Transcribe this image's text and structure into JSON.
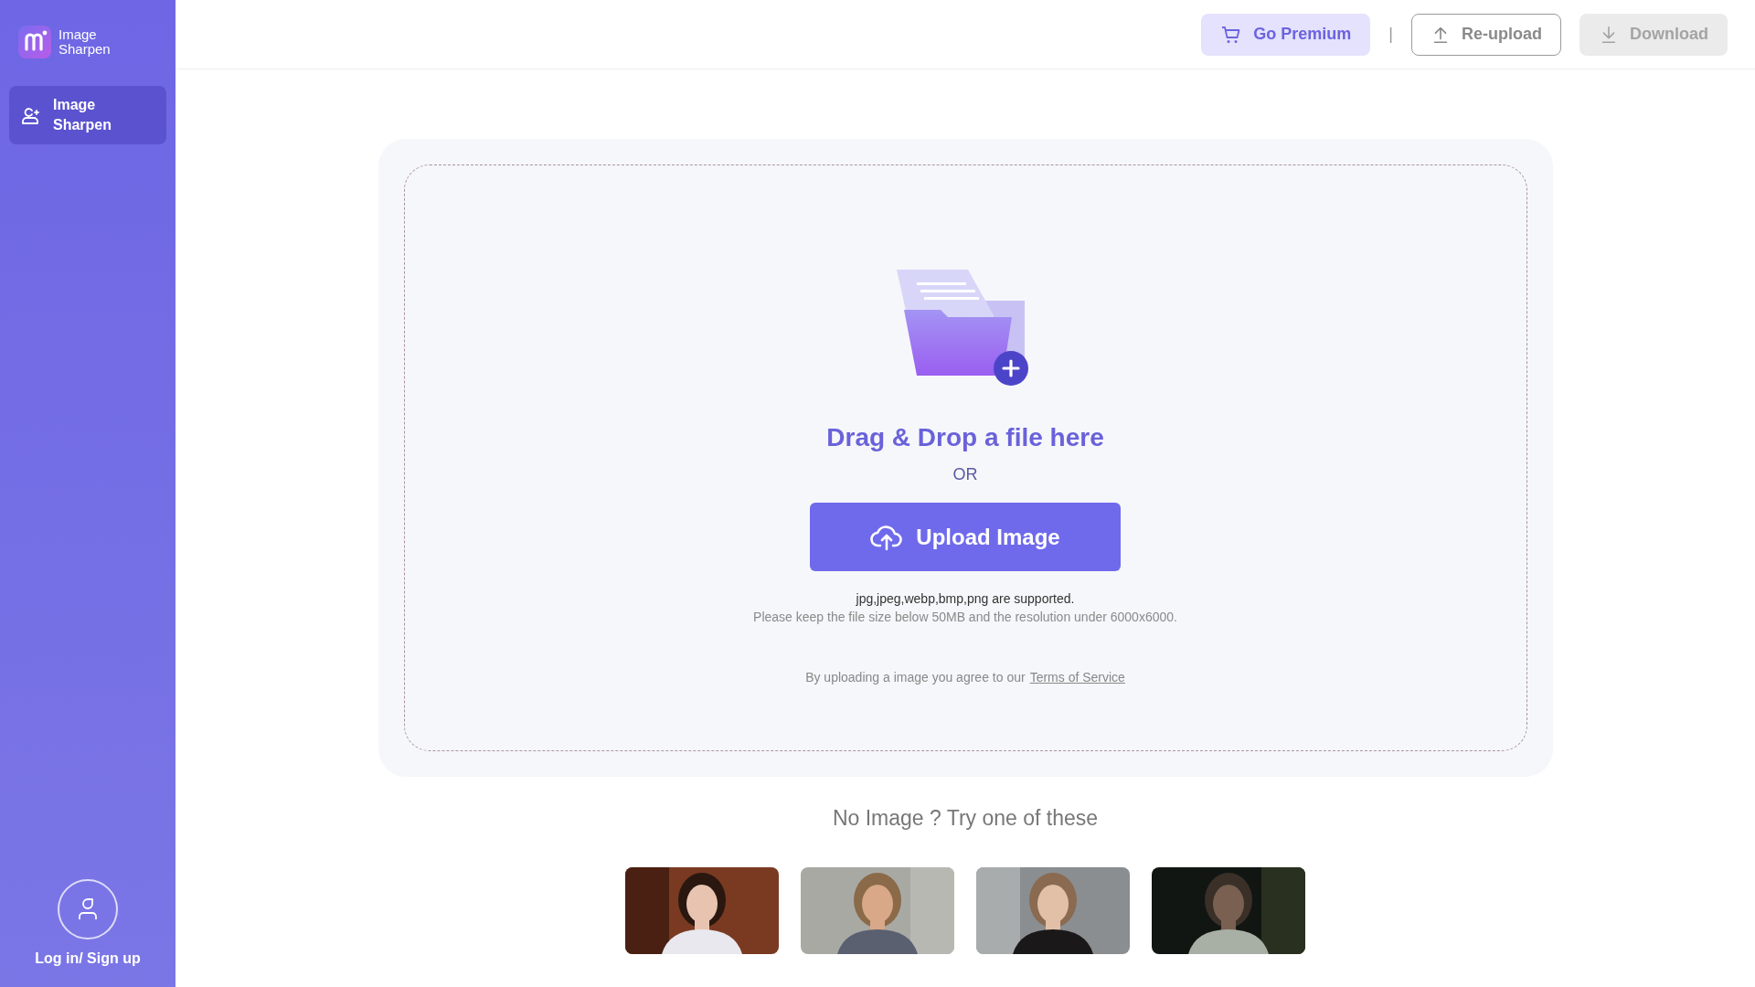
{
  "app": {
    "logo_text": "Image Sharpen"
  },
  "sidebar": {
    "items": [
      {
        "label": "Image Sharpen",
        "selected": true
      }
    ],
    "login": "Log in/ Sign up"
  },
  "toolbar": {
    "separator": "|",
    "buttons": [
      {
        "label": "Go Premium",
        "kind": "premium",
        "disabled": false
      },
      {
        "label": "Re-upload",
        "kind": "reupload",
        "disabled": false
      },
      {
        "label": "Download",
        "kind": "download",
        "disabled": true
      }
    ]
  },
  "upload": {
    "title": "Drag & Drop a file here",
    "or": "OR",
    "button": "Upload Image",
    "formats": "jpg,jpeg,webp,bmp,png are supported.",
    "limits": "Please keep the file size below 50MB and the resolution under 6000x6000.",
    "terms": {
      "text": "By uploading a image you agree to our",
      "link": "Terms of Service"
    }
  },
  "samples": {
    "title": "No Image ? Try one of these"
  }
}
